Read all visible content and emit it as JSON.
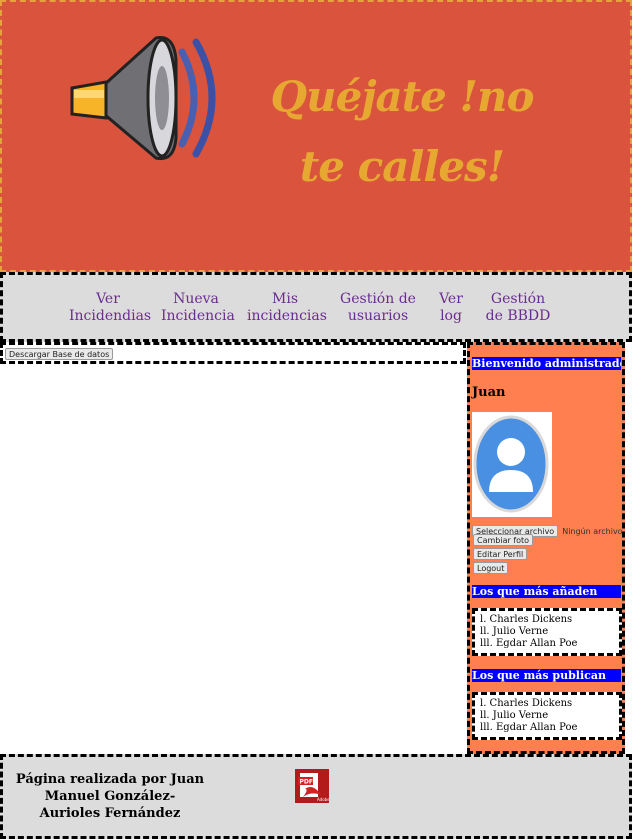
{
  "header": {
    "title": "Quéjate !no te calles!",
    "logo_icon": "megaphone-icon"
  },
  "nav": {
    "items": [
      {
        "label": "Ver Incidendias"
      },
      {
        "label": "Nueva Incidencia"
      },
      {
        "label": "Mis incidencias"
      },
      {
        "label": "Gestión de usuarios"
      },
      {
        "label": "Ver log"
      },
      {
        "label": "Gestión de BBDD"
      }
    ]
  },
  "main": {
    "download_label": "Descargar Base de datos"
  },
  "sidebar": {
    "welcome": "Bienvenido administrador",
    "user_name": "Juan",
    "avatar_icon": "user-avatar-icon",
    "file_button": "Seleccionar archivo",
    "file_status": "Ningún archivo seleccionado",
    "change_photo": "Cambiar foto",
    "edit_profile": "Editar Perfil",
    "logout": "Logout",
    "top_adders": {
      "title": "Los que más añaden",
      "items": [
        "l. Charles Dickens",
        "ll. Julio Verne",
        "lll. Egdar Allan Poe"
      ]
    },
    "top_publishers": {
      "title": "Los que más publican",
      "items": [
        "l. Charles Dickens",
        "ll. Julio Verne",
        "lll. Egdar Allan Poe"
      ]
    }
  },
  "footer": {
    "credit": "Página realizada por Juan Manuel González-Aurioles Fernández",
    "pdf_icon": "pdf-icon"
  },
  "colors": {
    "header_bg": "#d9533d",
    "title": "#e7a832",
    "nav_link": "#6b2c91",
    "sidebar_bg": "#ff7f50",
    "sidebar_bar": "#0000ff",
    "footer_bg": "#dcdcdc"
  }
}
